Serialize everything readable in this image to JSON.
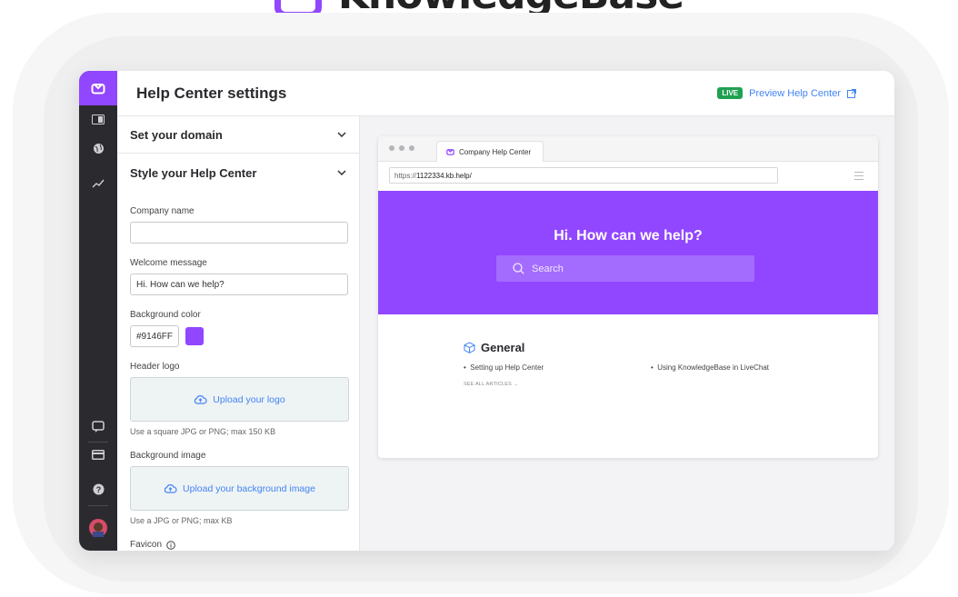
{
  "brand": {
    "name": "KnowledgeBase",
    "accent": "#9146ff"
  },
  "header": {
    "title": "Help Center settings",
    "live_badge": "LIVE",
    "preview_link": "Preview Help Center"
  },
  "rail": {
    "icons": [
      "app-logo-icon",
      "articles-icon",
      "globe-icon",
      "chart-icon",
      "chat-icon",
      "billing-icon",
      "help-icon",
      "avatar"
    ]
  },
  "settings": {
    "sections": [
      {
        "label": "Set your domain"
      },
      {
        "label": "Style your Help Center"
      }
    ],
    "company_name": {
      "label": "Company name",
      "value": ""
    },
    "welcome_message": {
      "label": "Welcome message",
      "value": "Hi. How can we help?"
    },
    "background_color": {
      "label": "Background color",
      "value": "#9146FF"
    },
    "header_logo": {
      "label": "Header logo",
      "upload_label": "Upload your logo",
      "hint": "Use a square JPG or PNG; max 150 KB"
    },
    "background_image": {
      "label": "Background image",
      "upload_label": "Upload your background image",
      "hint": "Use a JPG or PNG; max KB"
    },
    "favicon": {
      "label": "Favicon"
    }
  },
  "preview": {
    "tab_title": "Company Help Center",
    "url_prefix": "https://",
    "url_host": "1122334.kb.help/",
    "hero_heading": "Hi. How can we help?",
    "search_placeholder": "Search",
    "category": {
      "title": "General",
      "articles": [
        "Setting up Help Center",
        "Using KnowledgeBase in LiveChat"
      ],
      "see_all": "SEE ALL ARTICLES →"
    }
  }
}
